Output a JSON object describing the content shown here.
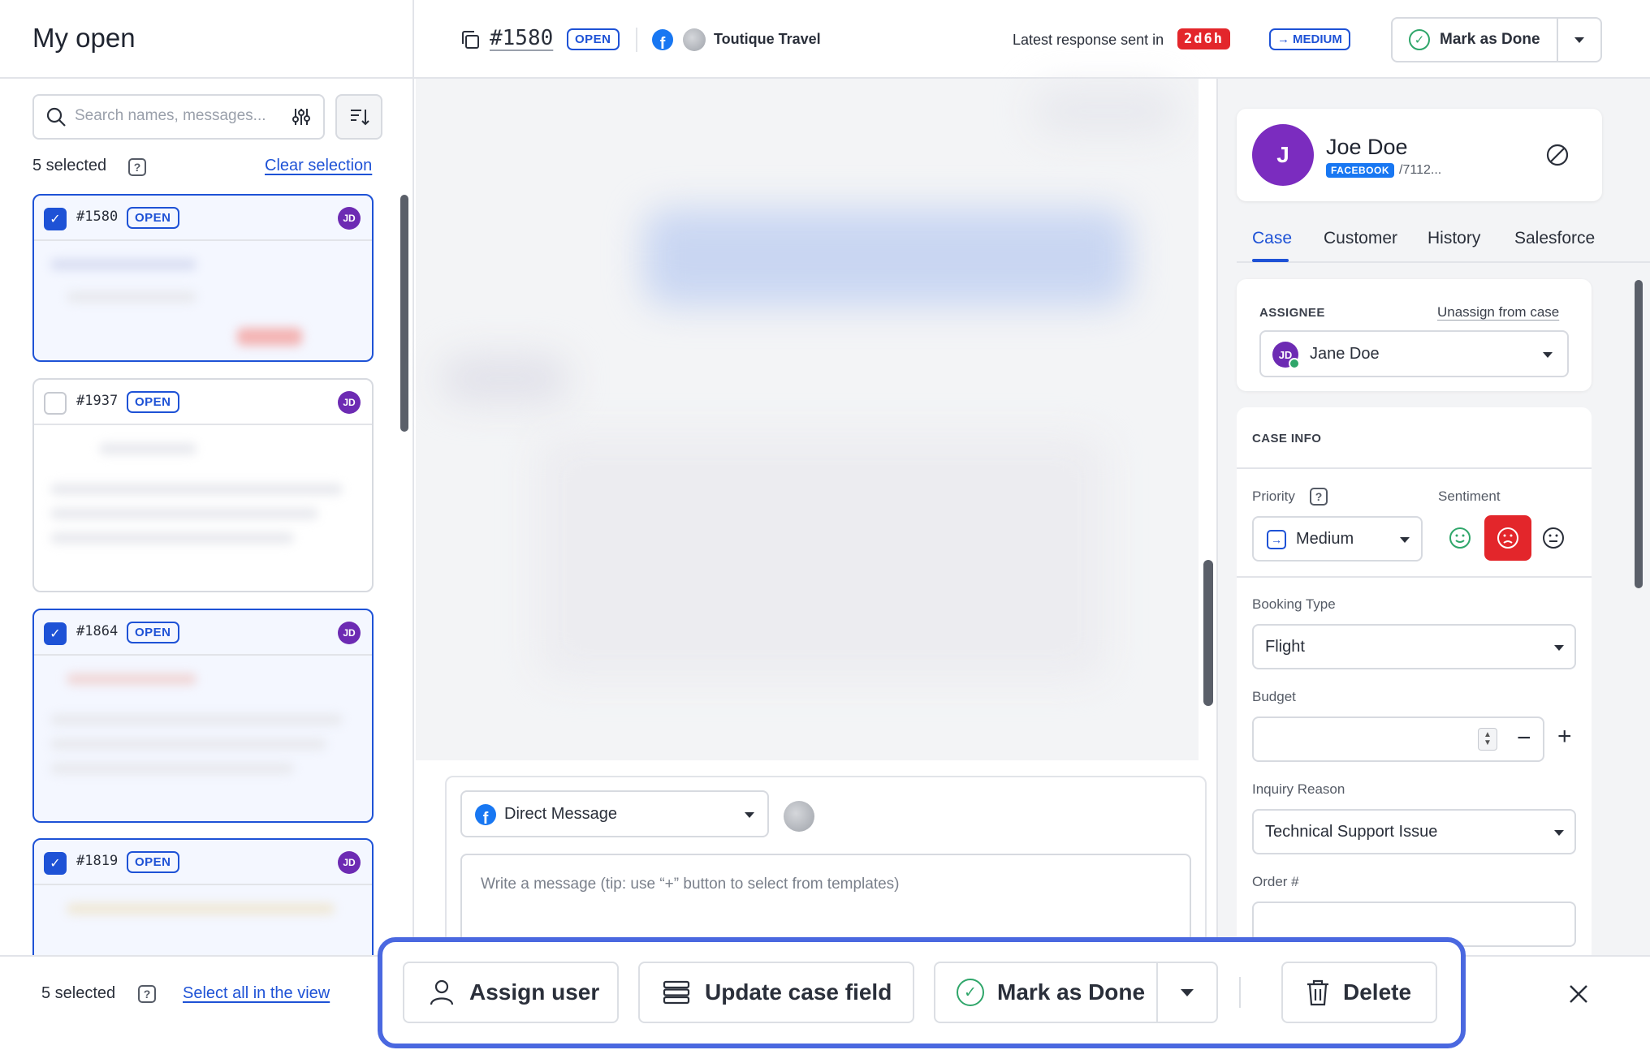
{
  "header": {
    "view_title": "My open",
    "case_id": "#1580",
    "case_status": "OPEN",
    "brand_name": "Toutique Travel",
    "latest_response_label": "Latest response sent in",
    "latest_response_time": "2d6h",
    "priority_badge": "MEDIUM",
    "mark_done_label": "Mark as Done"
  },
  "sidebar": {
    "search_placeholder": "Search names, messages...",
    "selected_count": "5 selected",
    "clear_selection": "Clear selection",
    "cases": [
      {
        "id": "#1580",
        "status": "OPEN",
        "initials": "JD",
        "checked": true
      },
      {
        "id": "#1937",
        "status": "OPEN",
        "initials": "JD",
        "checked": false
      },
      {
        "id": "#1864",
        "status": "OPEN",
        "initials": "JD",
        "checked": true
      },
      {
        "id": "#1819",
        "status": "OPEN",
        "initials": "JD",
        "checked": true
      }
    ]
  },
  "composer": {
    "channel": "Direct Message",
    "placeholder": "Write a message (tip: use “+” button to select from templates)"
  },
  "customer": {
    "avatar_letter": "J",
    "name": "Joe Doe",
    "source": "FACEBOOK",
    "handle": "/7112..."
  },
  "tabs": [
    "Case",
    "Customer",
    "History",
    "Salesforce"
  ],
  "case_panel": {
    "assignee_label": "ASSIGNEE",
    "unassign_label": "Unassign from case",
    "assignee_initials": "JD",
    "assignee_name": "Jane Doe",
    "case_info_label": "CASE INFO",
    "priority_label": "Priority",
    "priority_value": "Medium",
    "sentiment_label": "Sentiment",
    "sentiment_selected": "negative",
    "booking_type_label": "Booking Type",
    "booking_type_value": "Flight",
    "budget_label": "Budget",
    "budget_value": "",
    "inquiry_reason_label": "Inquiry Reason",
    "inquiry_reason_value": "Technical Support Issue",
    "order_label": "Order #",
    "order_value": ""
  },
  "bulk_bar": {
    "selected_count": "5 selected",
    "select_all": "Select all in the view",
    "assign_user": "Assign user",
    "update_case_field": "Update case field",
    "mark_done": "Mark as Done",
    "delete": "Delete"
  },
  "colors": {
    "accent": "#1e52d6",
    "highlight_frame": "#4a68e0",
    "alert_red": "#e3262b",
    "success_green": "#2fa66a",
    "avatar_purple": "#6d2bb3"
  }
}
